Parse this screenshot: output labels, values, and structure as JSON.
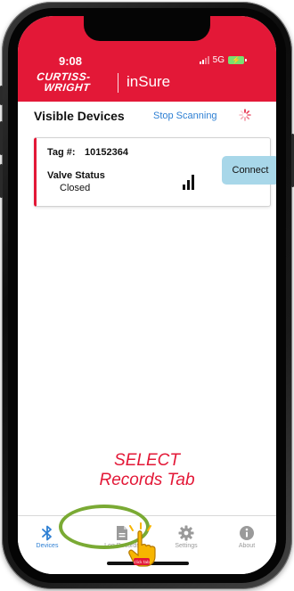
{
  "status_bar": {
    "time": "9:08",
    "network": "5G"
  },
  "brand": {
    "logo_line1": "CURTISS-",
    "logo_line2": "WRIGHT",
    "app_name": "inSure",
    "color": "#e31837"
  },
  "devices": {
    "title": "Visible Devices",
    "stop_scanning_label": "Stop Scanning",
    "items": [
      {
        "tag_label": "Tag #:",
        "tag_number": "10152364",
        "valve_status_label": "Valve Status",
        "valve_status_value": "Closed",
        "signal_bars": 3,
        "connect_label": "Connect"
      }
    ]
  },
  "instruction": {
    "line1": "SELECT",
    "line2": "Records Tab"
  },
  "tabs": [
    {
      "label": "Devices",
      "icon": "bluetooth-icon",
      "active": true
    },
    {
      "label": "Log Records",
      "icon": "document-icon",
      "active": false
    },
    {
      "label": "Settings",
      "icon": "gear-icon",
      "active": false
    },
    {
      "label": "About",
      "icon": "info-icon",
      "active": false
    }
  ],
  "pointer_badge": "click tab",
  "colors": {
    "accent": "#e31837",
    "link": "#2d7fd3",
    "connect_button": "#a8d7e9",
    "highlight": "#7aaa34",
    "pointer": "#f7b500"
  }
}
